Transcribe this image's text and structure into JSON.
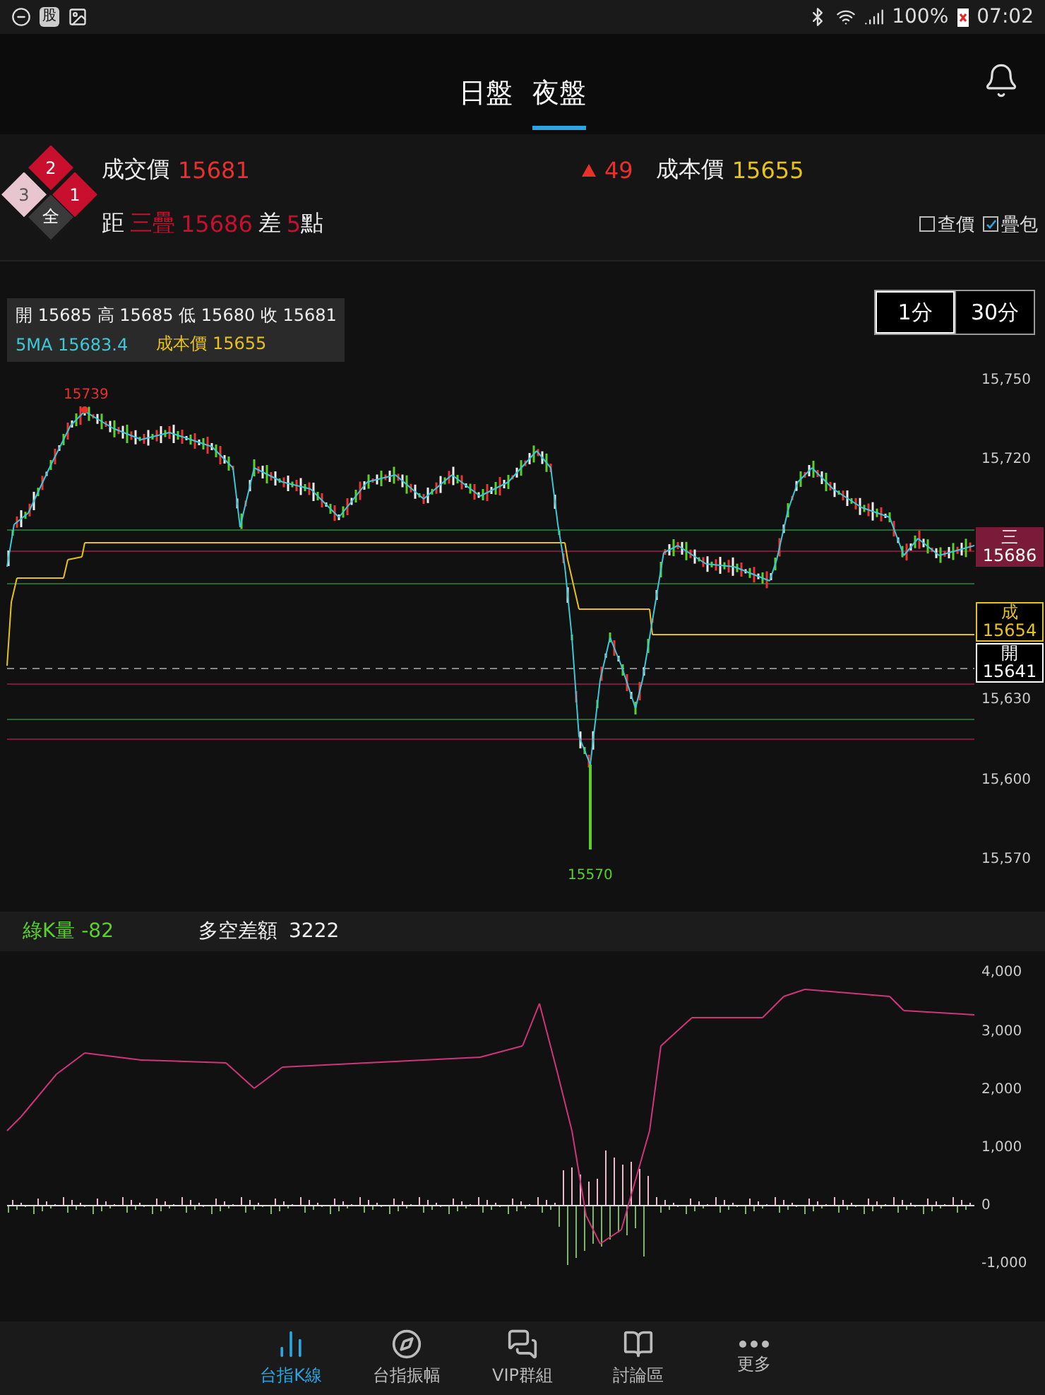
{
  "status_bar": {
    "app_badge": "股",
    "battery": "100%",
    "time": "07:02"
  },
  "header": {
    "tabs": [
      {
        "label": "日盤",
        "selected": false
      },
      {
        "label": "夜盤",
        "selected": true
      }
    ]
  },
  "quote": {
    "last_label": "成交價",
    "last_value": "15681",
    "change": "49",
    "cost_label": "成本價",
    "cost_value": "15655"
  },
  "levels": [
    {
      "label": "2",
      "color": "#c8102e"
    },
    {
      "label": "3",
      "color": "#e8c6cf"
    },
    {
      "label": "1",
      "color": "#c8102e"
    },
    {
      "label": "全",
      "color": "#3a3a3a"
    }
  ],
  "distance": {
    "prefix": "距",
    "level_name": "三疊",
    "level_value": "15686",
    "diff_label": "差",
    "diff_value": "5",
    "unit": "點"
  },
  "options": [
    {
      "label": "查價",
      "checked": false
    },
    {
      "label": "疊包",
      "checked": true
    }
  ],
  "intervals": [
    {
      "label": "1分",
      "selected": true
    },
    {
      "label": "30分",
      "selected": false
    }
  ],
  "legend": {
    "ohlc": "開 15685 高 15685 低 15680 收 15681",
    "ma": "5MA 15683.4",
    "cost": "成本價 15655"
  },
  "price_chart": {
    "high_label": "15739",
    "low_label": "15570",
    "y_ticks": [
      "15,750",
      "15,720",
      "15,630",
      "15,600",
      "15,570"
    ],
    "markers": [
      {
        "label": "三",
        "value": "15686",
        "kind": "filled",
        "color": "#7a1b3a"
      },
      {
        "label": "成",
        "value": "15654",
        "kind": "outlined",
        "color": "#e8c21a"
      },
      {
        "label": "開",
        "value": "15641",
        "kind": "outlined",
        "color": "#ffffff"
      }
    ]
  },
  "indicator_bar": {
    "green_volume": "綠K量 -82",
    "spread_label": "多空差額",
    "spread_value": "3222"
  },
  "spread_chart": {
    "y_ticks": [
      "4,000",
      "3,000",
      "2,000",
      "1,000",
      "0",
      "-1,000"
    ]
  },
  "nav": [
    {
      "label": "台指K線",
      "selected": true
    },
    {
      "label": "台指振幅",
      "selected": false
    },
    {
      "label": "VIP群組",
      "selected": false
    },
    {
      "label": "討論區",
      "selected": false
    },
    {
      "label": "更多",
      "selected": false
    }
  ]
}
